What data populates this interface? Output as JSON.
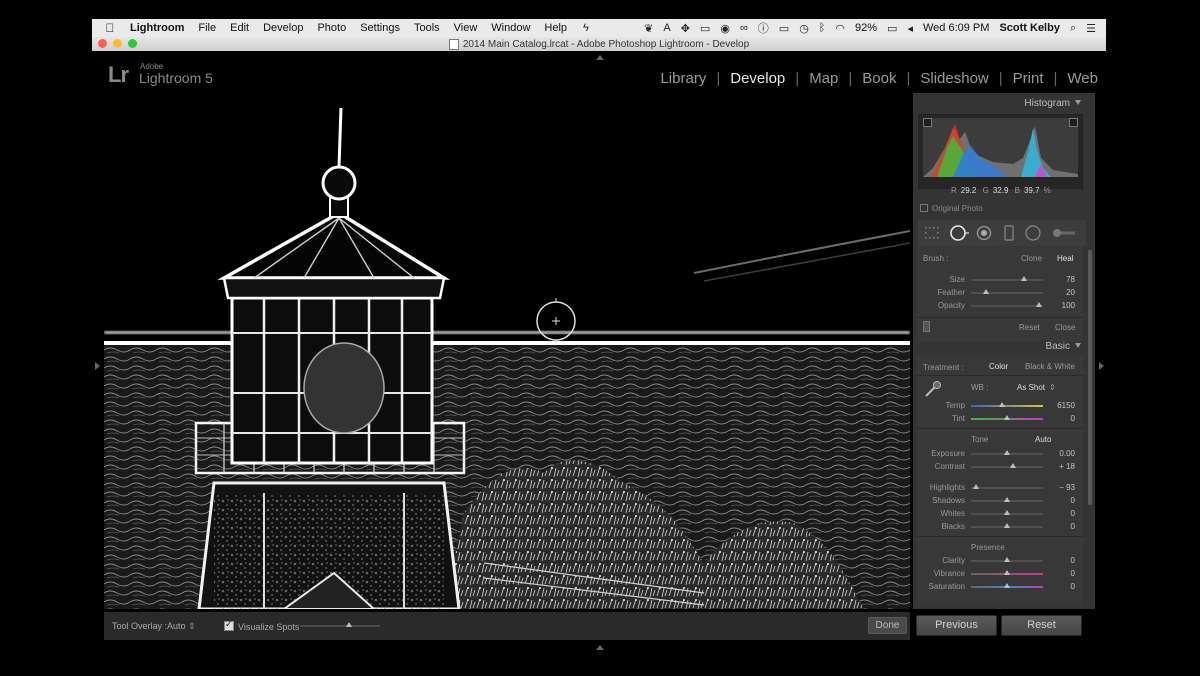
{
  "menubar": {
    "apple": "",
    "app": "Lightroom",
    "items": [
      "File",
      "Edit",
      "Develop",
      "Photo",
      "Settings",
      "Tools",
      "View",
      "Window",
      "Help"
    ],
    "battery": "92%",
    "clock": "Wed 6:09 PM",
    "user": "Scott Kelby"
  },
  "window": {
    "title": "2014 Main Catalog.lrcat - Adobe Photoshop Lightroom - Develop"
  },
  "brand": {
    "logo": "Lr",
    "small": "Adobe",
    "name": "Lightroom 5"
  },
  "modules": {
    "library": "Library",
    "develop": "Develop",
    "map": "Map",
    "book": "Book",
    "slideshow": "Slideshow",
    "print": "Print",
    "web": "Web"
  },
  "toolbar": {
    "overlay_label": "Tool Overlay :",
    "overlay_value": "Auto",
    "visualize_label": "Visualize Spots",
    "done": "Done"
  },
  "histogram": {
    "title": "Histogram",
    "r_label": "R",
    "r_value": "29.2",
    "g_label": "G",
    "g_value": "32.9",
    "b_label": "B",
    "b_value": "39.7",
    "percent": "%",
    "original_photo": "Original Photo"
  },
  "brush": {
    "label": "Brush :",
    "clone": "Clone",
    "heal": "Heal",
    "size_label": "Size",
    "size_value": "78",
    "feather_label": "Feather",
    "feather_value": "20",
    "opacity_label": "Opacity",
    "opacity_value": "100",
    "reset": "Reset",
    "close": "Close"
  },
  "basic": {
    "title": "Basic",
    "treatment_label": "Treatment :",
    "color": "Color",
    "bw": "Black & White",
    "wb_label": "WB :",
    "wb_value": "As Shot",
    "temp_label": "Temp",
    "temp_value": "6150",
    "tint_label": "Tint",
    "tint_value": "0",
    "tone": "Tone",
    "auto": "Auto",
    "exposure_label": "Exposure",
    "exposure_value": "0.00",
    "contrast_label": "Contrast",
    "contrast_value": "+ 18",
    "highlights_label": "Highlights",
    "highlights_value": "− 93",
    "shadows_label": "Shadows",
    "shadows_value": "0",
    "whites_label": "Whites",
    "whites_value": "0",
    "blacks_label": "Blacks",
    "blacks_value": "0",
    "presence": "Presence",
    "clarity_label": "Clarity",
    "clarity_value": "0",
    "vibrance_label": "Vibrance",
    "vibrance_value": "0",
    "saturation_label": "Saturation",
    "saturation_value": "0"
  },
  "panel_buttons": {
    "previous": "Previous",
    "reset": "Reset"
  }
}
